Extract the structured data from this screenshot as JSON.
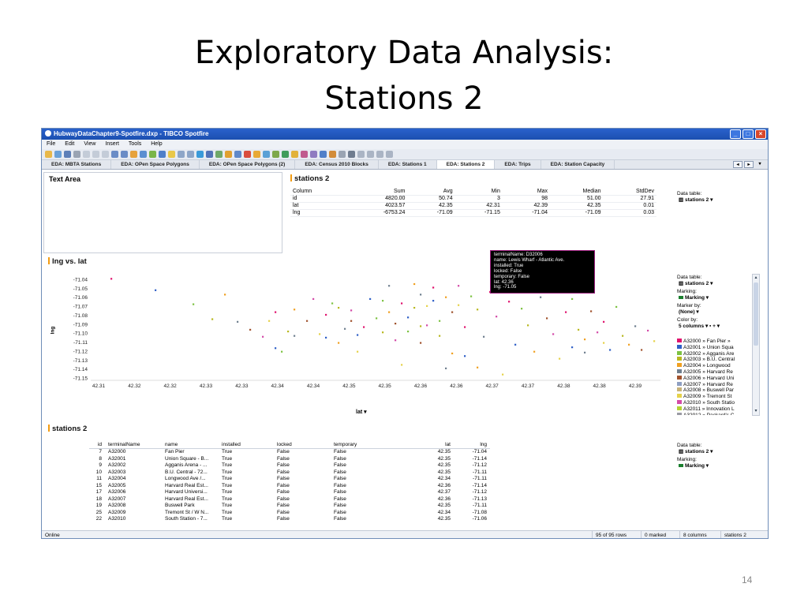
{
  "slide": {
    "title_line1": "Exploratory Data Analysis:",
    "title_line2": "Stations 2",
    "page_number": "14"
  },
  "window": {
    "title": "HubwayDataChapter9-Spotfire.dxp - TIBCO Spotfire",
    "menu": [
      "File",
      "Edit",
      "View",
      "Insert",
      "Tools",
      "Help"
    ]
  },
  "tabs": [
    {
      "label": "EDA: MBTA Stations",
      "active": false
    },
    {
      "label": "EDA: OPen Space Polygons",
      "active": false
    },
    {
      "label": "EDA: OPen Space Polygons (2)",
      "active": false
    },
    {
      "label": "EDA: Census 2010 Blocks",
      "active": false
    },
    {
      "label": "EDA: Stations 1",
      "active": false
    },
    {
      "label": "EDA: Stations 2",
      "active": true
    },
    {
      "label": "EDA: Trips",
      "active": false
    },
    {
      "label": "EDA: Station Capacity",
      "active": false
    }
  ],
  "text_area": {
    "title": "Text Area"
  },
  "summary": {
    "title": "stations 2",
    "columns": [
      "Column",
      "Sum",
      "Avg",
      "Min",
      "Max",
      "Median",
      "StdDev"
    ],
    "rows": [
      [
        "id",
        "4820.00",
        "50.74",
        "3",
        "98",
        "51.00",
        "27.91"
      ],
      [
        "lat",
        "4023.57",
        "42.35",
        "42.31",
        "42.39",
        "42.35",
        "0.01"
      ],
      [
        "lng",
        "-6753.24",
        "-71.09",
        "-71.15",
        "-71.04",
        "-71.09",
        "0.03"
      ]
    ],
    "data_table_label": "Data table:",
    "data_table_value": "stations 2"
  },
  "scatter_panel": {
    "title": "lng vs. lat",
    "x_selector": "lat",
    "side": {
      "data_table_label": "Data table:",
      "data_table_value": "stations 2",
      "marking_label": "Marking:",
      "marking_value": "Marking",
      "marker_by_label": "Marker by:",
      "marker_by_value": "(None)",
      "color_by_label": "Color by:",
      "color_by_value": "5 columns"
    },
    "legend": [
      {
        "label": "A32000 » Fan Pier »",
        "color": "#e0146e"
      },
      {
        "label": "A32001 » Union Squa",
        "color": "#2f5fc7"
      },
      {
        "label": "A32002 » Agganis Are",
        "color": "#7dc242"
      },
      {
        "label": "A32003 » B.U. Central",
        "color": "#b8b820"
      },
      {
        "label": "A32004 » Longwood",
        "color": "#f0a020"
      },
      {
        "label": "A32005 » Harvard Re",
        "color": "#6f7f8f"
      },
      {
        "label": "A32006 » Harvard Uni",
        "color": "#a0522d"
      },
      {
        "label": "A32007 » Harvard Re",
        "color": "#8e9fc2"
      },
      {
        "label": "A32008 » Buswell Par",
        "color": "#c7b27a"
      },
      {
        "label": "A32009 » Tremont St",
        "color": "#e6d24a"
      },
      {
        "label": "A32010 » South Statio",
        "color": "#d44ba8"
      },
      {
        "label": "A32011 » Innovation L",
        "color": "#b5d334"
      },
      {
        "label": "A32012 » Packard's C",
        "color": "#9a9aa4"
      },
      {
        "label": "A32017 » Mlston Cro",
        "color": "#c8a0a0"
      }
    ],
    "tooltip": [
      "terminalName: D32006",
      "name: Lewis Wharf - Atlantic Ave.",
      "installed: True",
      "locked: False",
      "temporary: False",
      "lat: 42.36",
      "lng: -71.05"
    ]
  },
  "chart_data": {
    "type": "scatter",
    "title": "lng vs. lat",
    "xlabel": "lat",
    "ylabel": "lng",
    "xlim": [
      42.305,
      42.395
    ],
    "ylim": [
      -71.15,
      -71.035
    ],
    "x_ticks": [
      "42.31",
      "42.32",
      "42.32",
      "42.33",
      "42.33",
      "42.34",
      "42.34",
      "42.35",
      "42.35",
      "42.36",
      "42.36",
      "42.37",
      "42.37",
      "42.38",
      "42.38",
      "42.39"
    ],
    "y_ticks": [
      "-71.04",
      "-71.05",
      "-71.06",
      "-71.07",
      "-71.08",
      "-71.09",
      "-71.10",
      "-71.11",
      "-71.12",
      "-71.13",
      "-71.14",
      "-71.15"
    ],
    "grid": true,
    "legend": "right",
    "colors": [
      "#e0146e",
      "#2f5fc7",
      "#7dc242",
      "#b8b820",
      "#f0a020",
      "#6f7f8f",
      "#a0522d",
      "#d44ba8",
      "#e6d24a"
    ],
    "points": [
      {
        "x": 42.308,
        "y": -71.037
      },
      {
        "x": 42.315,
        "y": -71.05
      },
      {
        "x": 42.321,
        "y": -71.066
      },
      {
        "x": 42.324,
        "y": -71.083
      },
      {
        "x": 42.326,
        "y": -71.055
      },
      {
        "x": 42.328,
        "y": -71.086
      },
      {
        "x": 42.33,
        "y": -71.095
      },
      {
        "x": 42.332,
        "y": -71.103
      },
      {
        "x": 42.333,
        "y": -71.085
      },
      {
        "x": 42.334,
        "y": -71.075
      },
      {
        "x": 42.334,
        "y": -71.116
      },
      {
        "x": 42.335,
        "y": -71.12
      },
      {
        "x": 42.336,
        "y": -71.097
      },
      {
        "x": 42.337,
        "y": -71.072
      },
      {
        "x": 42.337,
        "y": -71.102
      },
      {
        "x": 42.339,
        "y": -71.085
      },
      {
        "x": 42.34,
        "y": -71.06
      },
      {
        "x": 42.341,
        "y": -71.1
      },
      {
        "x": 42.342,
        "y": -71.078
      },
      {
        "x": 42.342,
        "y": -71.104
      },
      {
        "x": 42.343,
        "y": -71.065
      },
      {
        "x": 42.344,
        "y": -71.07
      },
      {
        "x": 42.344,
        "y": -71.11
      },
      {
        "x": 42.345,
        "y": -71.094
      },
      {
        "x": 42.346,
        "y": -71.085
      },
      {
        "x": 42.346,
        "y": -71.073
      },
      {
        "x": 42.347,
        "y": -71.12
      },
      {
        "x": 42.348,
        "y": -71.092
      },
      {
        "x": 42.349,
        "y": -71.06
      },
      {
        "x": 42.35,
        "y": -71.082
      },
      {
        "x": 42.351,
        "y": -71.098
      },
      {
        "x": 42.352,
        "y": -71.075
      },
      {
        "x": 42.352,
        "y": -71.045
      },
      {
        "x": 42.353,
        "y": -71.088
      },
      {
        "x": 42.353,
        "y": -71.107
      },
      {
        "x": 42.354,
        "y": -71.135
      },
      {
        "x": 42.354,
        "y": -71.065
      },
      {
        "x": 42.355,
        "y": -71.081
      },
      {
        "x": 42.355,
        "y": -71.097
      },
      {
        "x": 42.356,
        "y": -71.07
      },
      {
        "x": 42.356,
        "y": -71.043
      },
      {
        "x": 42.357,
        "y": -71.055
      },
      {
        "x": 42.357,
        "y": -71.11
      },
      {
        "x": 42.358,
        "y": -71.09
      },
      {
        "x": 42.358,
        "y": -71.068
      },
      {
        "x": 42.359,
        "y": -71.047
      },
      {
        "x": 42.359,
        "y": -71.062
      },
      {
        "x": 42.36,
        "y": -71.085
      },
      {
        "x": 42.36,
        "y": -71.102
      },
      {
        "x": 42.361,
        "y": -71.058
      },
      {
        "x": 42.361,
        "y": -71.139
      },
      {
        "x": 42.362,
        "y": -71.075
      },
      {
        "x": 42.363,
        "y": -71.045
      },
      {
        "x": 42.363,
        "y": -71.067
      },
      {
        "x": 42.364,
        "y": -71.092
      },
      {
        "x": 42.364,
        "y": -71.125
      },
      {
        "x": 42.365,
        "y": -71.057
      },
      {
        "x": 42.366,
        "y": -71.072
      },
      {
        "x": 42.366,
        "y": -71.138
      },
      {
        "x": 42.367,
        "y": -71.103
      },
      {
        "x": 42.368,
        "y": -71.052
      },
      {
        "x": 42.369,
        "y": -71.08
      },
      {
        "x": 42.37,
        "y": -71.146
      },
      {
        "x": 42.371,
        "y": -71.063
      },
      {
        "x": 42.372,
        "y": -71.112
      },
      {
        "x": 42.373,
        "y": -71.071
      },
      {
        "x": 42.374,
        "y": -71.09
      },
      {
        "x": 42.375,
        "y": -71.12
      },
      {
        "x": 42.376,
        "y": -71.058
      },
      {
        "x": 42.377,
        "y": -71.082
      },
      {
        "x": 42.378,
        "y": -71.1
      },
      {
        "x": 42.379,
        "y": -71.128
      },
      {
        "x": 42.38,
        "y": -71.075
      },
      {
        "x": 42.381,
        "y": -71.115
      },
      {
        "x": 42.381,
        "y": -71.06
      },
      {
        "x": 42.382,
        "y": -71.095
      },
      {
        "x": 42.383,
        "y": -71.106
      },
      {
        "x": 42.383,
        "y": -71.121
      },
      {
        "x": 42.384,
        "y": -71.074
      },
      {
        "x": 42.385,
        "y": -71.098
      },
      {
        "x": 42.386,
        "y": -71.11
      },
      {
        "x": 42.386,
        "y": -71.086
      },
      {
        "x": 42.387,
        "y": -71.118
      },
      {
        "x": 42.388,
        "y": -71.069
      },
      {
        "x": 42.389,
        "y": -71.102
      },
      {
        "x": 42.39,
        "y": -71.112
      },
      {
        "x": 42.391,
        "y": -71.091
      },
      {
        "x": 42.392,
        "y": -71.118
      },
      {
        "x": 42.393,
        "y": -71.096
      },
      {
        "x": 42.394,
        "y": -71.108
      },
      {
        "x": 42.368,
        "y": -71.052
      },
      {
        "x": 42.347,
        "y": -71.101
      },
      {
        "x": 42.351,
        "y": -71.062
      },
      {
        "x": 42.357,
        "y": -71.091
      },
      {
        "x": 42.362,
        "y": -71.122
      }
    ]
  },
  "data_panel": {
    "title": "stations 2",
    "columns": [
      "id",
      "terminalName",
      "name",
      "installed",
      "locked",
      "temporary",
      "lat",
      "lng"
    ],
    "rows": [
      [
        "7",
        "A32000",
        "Fan Pier",
        "True",
        "False",
        "False",
        "42.35",
        "-71.04"
      ],
      [
        "8",
        "A32001",
        "Union Square - B...",
        "True",
        "False",
        "False",
        "42.35",
        "-71.14"
      ],
      [
        "9",
        "A32002",
        "Agganis Arena - ...",
        "True",
        "False",
        "False",
        "42.35",
        "-71.12"
      ],
      [
        "10",
        "A32003",
        "B.U. Central - 72...",
        "True",
        "False",
        "False",
        "42.35",
        "-71.11"
      ],
      [
        "11",
        "A32004",
        "Longwood Ave /...",
        "True",
        "False",
        "False",
        "42.34",
        "-71.11"
      ],
      [
        "15",
        "A32005",
        "Harvard Real Est...",
        "True",
        "False",
        "False",
        "42.36",
        "-71.14"
      ],
      [
        "17",
        "A32006",
        "Harvard Universi...",
        "True",
        "False",
        "False",
        "42.37",
        "-71.12"
      ],
      [
        "18",
        "A32007",
        "Harvard Real Est...",
        "True",
        "False",
        "False",
        "42.36",
        "-71.13"
      ],
      [
        "19",
        "A32008",
        "Buswell Park",
        "True",
        "False",
        "False",
        "42.35",
        "-71.11"
      ],
      [
        "25",
        "A32009",
        "Tremont St / W N...",
        "True",
        "False",
        "False",
        "42.34",
        "-71.08"
      ],
      [
        "22",
        "A32010",
        "South Station - 7...",
        "True",
        "False",
        "False",
        "42.35",
        "-71.06"
      ]
    ],
    "side": {
      "data_table_label": "Data table:",
      "data_table_value": "stations 2",
      "marking_label": "Marking:",
      "marking_value": "Marking"
    }
  },
  "status": {
    "left": "Online",
    "rows": "95 of 95 rows",
    "marked": "0 marked",
    "columns": "8 columns",
    "table": "stations 2"
  }
}
